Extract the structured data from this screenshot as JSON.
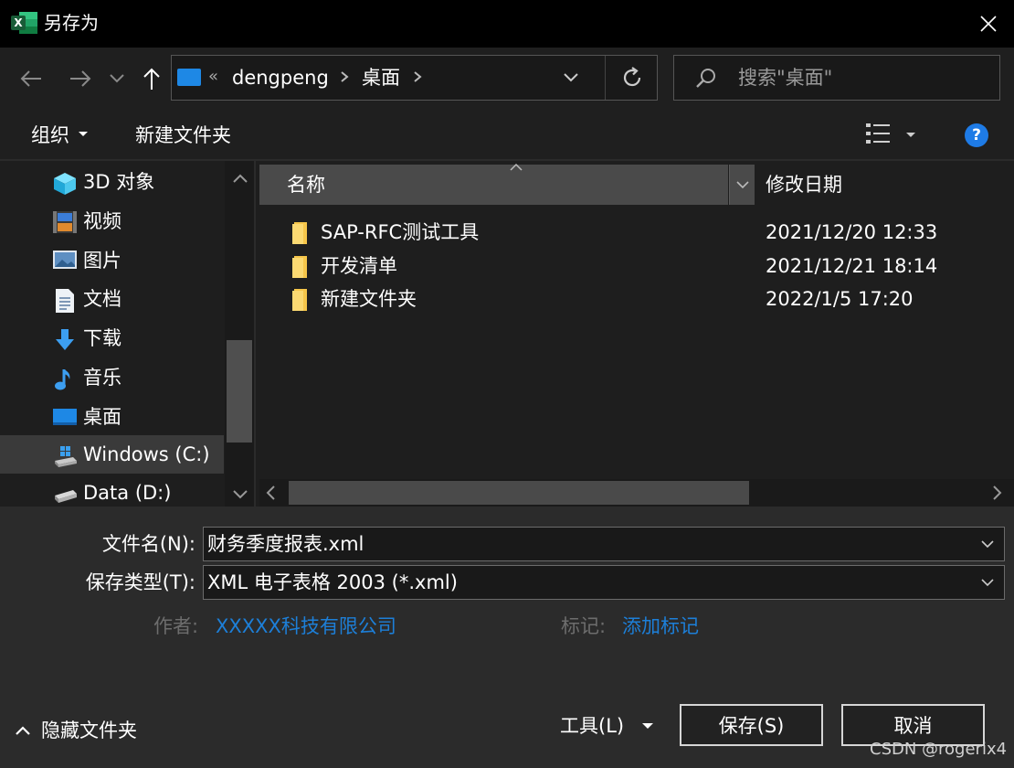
{
  "window": {
    "title": "另存为"
  },
  "nav": {
    "address": {
      "crumbs": [
        "dengpeng",
        "桌面"
      ],
      "overflow": "«"
    },
    "search_placeholder": "搜索\"桌面\""
  },
  "toolbar": {
    "organize": "组织",
    "new_folder": "新建文件夹"
  },
  "sidebar": {
    "items": [
      {
        "label": "3D 对象"
      },
      {
        "label": "视频"
      },
      {
        "label": "图片"
      },
      {
        "label": "文档"
      },
      {
        "label": "下载"
      },
      {
        "label": "音乐"
      },
      {
        "label": "桌面"
      },
      {
        "label": "Windows (C:)"
      },
      {
        "label": "Data (D:)"
      }
    ],
    "selected": "Windows (C:)"
  },
  "files": {
    "columns": {
      "name": "名称",
      "date": "修改日期"
    },
    "rows": [
      {
        "name": "SAP-RFC测试工具",
        "date": "2021/12/20 12:33"
      },
      {
        "name": "开发清单",
        "date": "2021/12/21 18:14"
      },
      {
        "name": "新建文件夹",
        "date": "2022/1/5 17:20"
      }
    ]
  },
  "form": {
    "filename_label": "文件名(N):",
    "filename_value": "财务季度报表.xml",
    "filetype_label": "保存类型(T):",
    "filetype_value": "XML 电子表格 2003 (*.xml)",
    "author_label": "作者:",
    "author_value": "XXXXX科技有限公司",
    "tags_label": "标记:",
    "tags_value": "添加标记"
  },
  "footer": {
    "hide_folders": "隐藏文件夹",
    "tools": "工具(L)",
    "save": "保存(S)",
    "cancel": "取消",
    "watermark": "CSDN @rogerix4"
  },
  "colors": {
    "accent": "#1e7be6",
    "link": "#1d7fd8",
    "folder": "#f6c64a"
  },
  "icons": [
    "excel-app-icon",
    "close-icon",
    "back-arrow-icon",
    "forward-arrow-icon",
    "up-arrow-icon",
    "refresh-icon",
    "search-icon",
    "view-options-icon",
    "help-icon",
    "folder-icon",
    "chevron-down-icon"
  ]
}
